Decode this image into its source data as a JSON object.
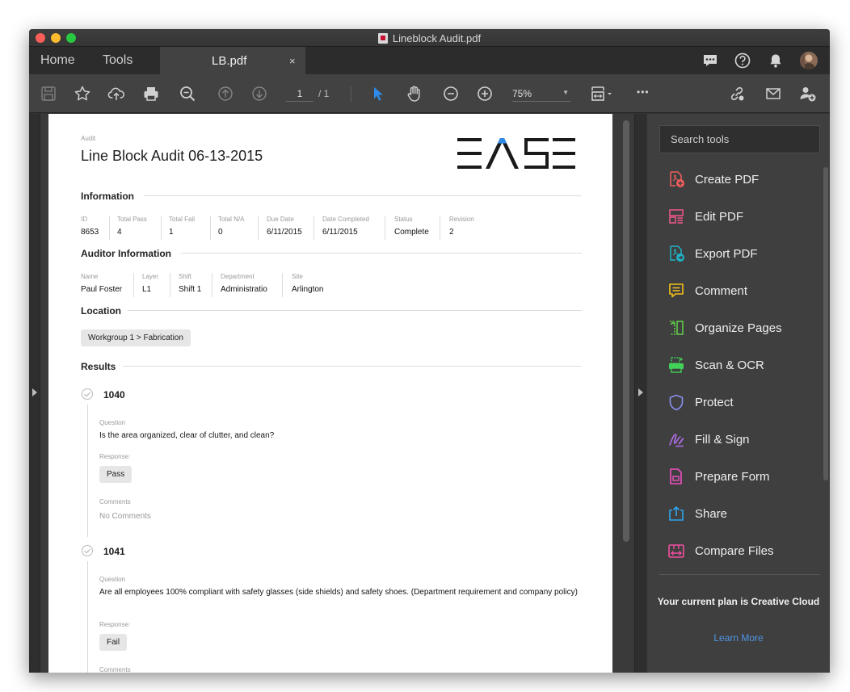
{
  "window": {
    "title": "Lineblock Audit.pdf"
  },
  "tabs": {
    "home": "Home",
    "tools": "Tools",
    "document": "LB.pdf",
    "close": "×"
  },
  "toolbar": {
    "page_current": "1",
    "page_total": "/ 1",
    "zoom": "75%",
    "more": "•••",
    "zoom_caret": "▼"
  },
  "colors": {
    "accent_blue": "#2d8ceb",
    "learn_link": "#4f95e6"
  },
  "document": {
    "type_label": "Audit",
    "title": "Line Block Audit 06-13-2015",
    "logo": "EASE",
    "information": {
      "heading": "Information",
      "fields": [
        {
          "label": "ID",
          "value": "8653"
        },
        {
          "label": "Total Pass",
          "value": "4"
        },
        {
          "label": "Total Fail",
          "value": "1"
        },
        {
          "label": "Total N/A",
          "value": "0"
        },
        {
          "label": "Due Date",
          "value": "6/11/2015"
        },
        {
          "label": "Date Completed",
          "value": "6/11/2015"
        },
        {
          "label": "Status",
          "value": "Complete"
        },
        {
          "label": "Revision",
          "value": "2"
        }
      ]
    },
    "auditor": {
      "heading": "Auditor Information",
      "fields": [
        {
          "label": "Name",
          "value": "Paul Foster"
        },
        {
          "label": "Layer",
          "value": "L1"
        },
        {
          "label": "Shift",
          "value": "Shift 1"
        },
        {
          "label": "Department",
          "value": "Administratio"
        },
        {
          "label": "Site",
          "value": "Arlington"
        }
      ]
    },
    "location": {
      "heading": "Location",
      "value": "Workgroup 1 > Fabrication"
    },
    "results": {
      "heading": "Results",
      "items": [
        {
          "id": "1040",
          "question_label": "Question",
          "question": "Is the area organized, clear of clutter, and clean?",
          "response_label": "Response:",
          "response": "Pass",
          "comments_label": "Comments",
          "comments": "No Comments"
        },
        {
          "id": "1041",
          "question_label": "Question",
          "question": "Are all employees 100% compliant with safety glasses (side shields) and safety shoes. (Department requirement and company policy)",
          "response_label": "Response:",
          "response": "Fail",
          "comments_label": "Comments"
        }
      ]
    }
  },
  "panel": {
    "search_placeholder": "Search tools",
    "tools": [
      {
        "label": "Create PDF",
        "icon": "create-pdf-icon",
        "color": "#f25e5e"
      },
      {
        "label": "Edit PDF",
        "icon": "edit-pdf-icon",
        "color": "#f2588a"
      },
      {
        "label": "Export PDF",
        "icon": "export-pdf-icon",
        "color": "#1fb5c9"
      },
      {
        "label": "Comment",
        "icon": "comment-icon",
        "color": "#f4c018"
      },
      {
        "label": "Organize Pages",
        "icon": "organize-pages-icon",
        "color": "#63d44b"
      },
      {
        "label": "Scan & OCR",
        "icon": "scan-ocr-icon",
        "color": "#42d25a"
      },
      {
        "label": "Protect",
        "icon": "protect-icon",
        "color": "#8b8ff0"
      },
      {
        "label": "Fill & Sign",
        "icon": "fill-sign-icon",
        "color": "#b06ce6"
      },
      {
        "label": "Prepare Form",
        "icon": "prepare-form-icon",
        "color": "#f04fc2"
      },
      {
        "label": "Share",
        "icon": "share-icon",
        "color": "#2ea6f0"
      },
      {
        "label": "Compare Files",
        "icon": "compare-files-icon",
        "color": "#f04fa0"
      }
    ],
    "plan_text": "Your current plan is Creative Cloud",
    "learn_more": "Learn More"
  }
}
